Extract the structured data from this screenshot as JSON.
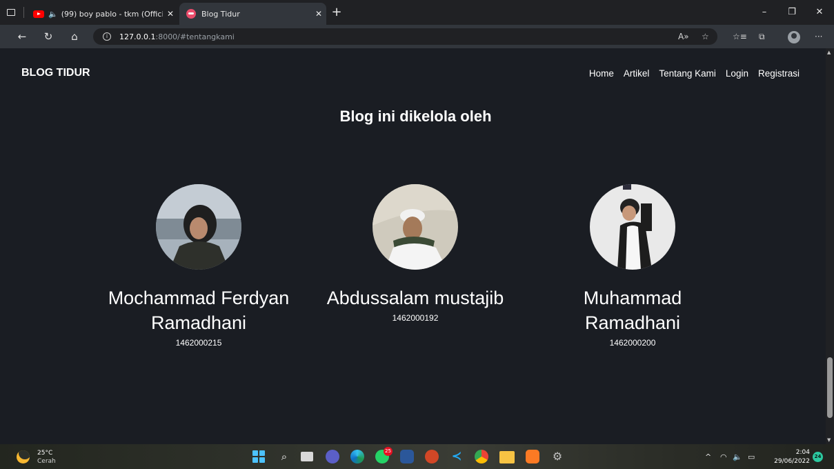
{
  "browser": {
    "tabs": [
      {
        "title": "(99) boy pablo - tkm (Offici"
      },
      {
        "title": "Blog Tidur"
      }
    ],
    "url_host": "127.0.0.1",
    "url_rest": ":8000/#tentangkami"
  },
  "site": {
    "brand": "BLOG TIDUR",
    "nav": [
      "Home",
      "Artikel",
      "Tentang Kami",
      "Login",
      "Registrasi"
    ],
    "section_title": "Blog ini dikelola oleh",
    "members": [
      {
        "name": "Mochammad Ferdyan Ramadhani",
        "nim": "1462000215"
      },
      {
        "name": "Abdussalam mustajib",
        "nim": "1462000192"
      },
      {
        "name": "Muhammad Ramadhani",
        "nim": "1462000200"
      }
    ]
  },
  "taskbar": {
    "weather_temp": "25°C",
    "weather_desc": "Cerah",
    "whatsapp_badge": "25",
    "time": "2:04",
    "date": "29/06/2022",
    "notifications": "24"
  },
  "colors": {
    "page_bg": "#1a1d23",
    "tab_bar": "#202124",
    "toolbar": "#32363c",
    "accent": "#ea4c6b"
  },
  "icons": [
    "tab-actions-icon",
    "youtube-icon",
    "speaker-icon",
    "close-icon",
    "new-tab-icon",
    "minimize-icon",
    "restore-icon",
    "back-icon",
    "refresh-icon",
    "home-icon",
    "info-icon",
    "read-aloud-icon",
    "favorite-icon",
    "favorites-icon",
    "collections-icon",
    "profile-icon",
    "more-icon",
    "windows-start-icon",
    "search-icon",
    "task-view-icon",
    "meet-icon",
    "edge-icon",
    "whatsapp-icon",
    "word-icon",
    "powerpoint-icon",
    "vscode-icon",
    "chrome-icon",
    "file-explorer-icon",
    "xampp-icon",
    "settings-icon",
    "wifi-icon",
    "volume-icon",
    "battery-icon"
  ]
}
